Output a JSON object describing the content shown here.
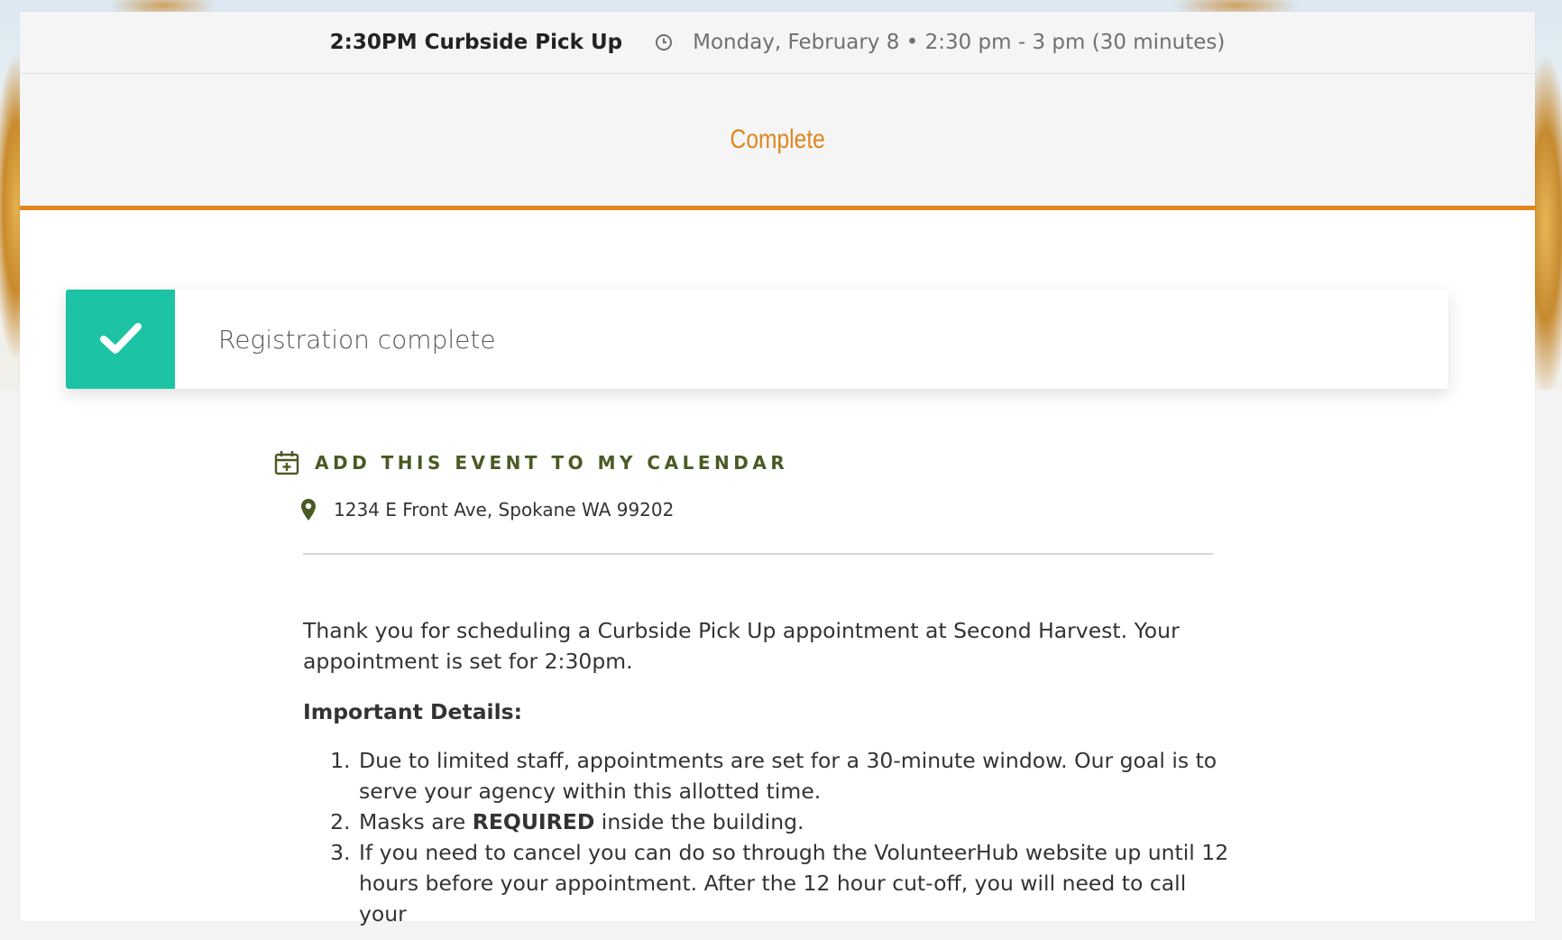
{
  "event": {
    "title": "2:30PM Curbside Pick Up",
    "time": "Monday, February 8 • 2:30 pm - 3 pm (30 minutes)"
  },
  "status": {
    "label": "Complete",
    "color": "#e0861d"
  },
  "alert": {
    "message": "Registration complete",
    "icon": "checkmark-icon",
    "color": "#1cc3a4"
  },
  "calendar": {
    "label": "ADD THIS EVENT TO MY CALENDAR",
    "icon": "calendar-plus-icon"
  },
  "location": {
    "address": "1234 E Front Ave, Spokane WA 99202",
    "icon": "map-pin-icon"
  },
  "content": {
    "intro": "Thank you for scheduling a Curbside Pick Up appointment at Second Harvest. Your appointment is set for 2:30pm.",
    "details_heading": "Important Details:",
    "item1": "Due to limited staff, appointments are set for a 30-minute window. Our goal is to serve your agency within this allotted time.",
    "item2_pre": "Masks are ",
    "item2_bold": "REQUIRED",
    "item2_post": " inside the building.",
    "item3_pre": "If you need to cancel you can do so through the ",
    "item3_link": "VolunteerHub",
    "item3_post": " website up until 12 hours before your appointment. After the 12 hour cut-off, you will need to call your"
  }
}
